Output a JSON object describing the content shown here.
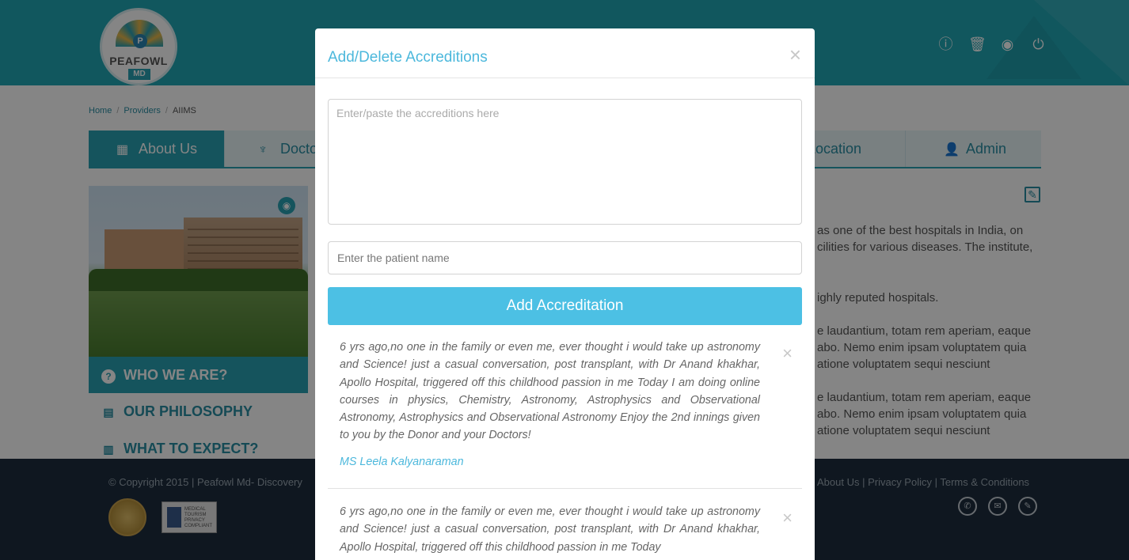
{
  "header": {
    "logo_name": "PEAFOWL",
    "logo_sub": "MD",
    "logo_letter": "P",
    "icons": [
      {
        "name": "info-icon",
        "glyph": "ⓘ"
      },
      {
        "name": "trash-icon",
        "glyph": "🗑"
      },
      {
        "name": "user-circle-icon",
        "glyph": "◉"
      },
      {
        "name": "power-icon",
        "glyph": "⏻"
      }
    ]
  },
  "breadcrumb": {
    "items": [
      "Home",
      "Providers",
      "AIIMS"
    ],
    "sep": "/"
  },
  "tabs": [
    {
      "label": "About Us",
      "icon": "▦"
    },
    {
      "label": "Docto",
      "icon": "♆"
    },
    {
      "label": "Location",
      "icon": ""
    },
    {
      "label": "Admin",
      "icon": "👤"
    }
  ],
  "sidebar": [
    {
      "label": "WHO WE ARE?",
      "icon": "?"
    },
    {
      "label": "OUR PHILOSOPHY",
      "icon": "▤"
    },
    {
      "label": "WHAT TO EXPECT?",
      "icon": "▥"
    }
  ],
  "body_text": [
    "as one of the best hospitals in India, on",
    "cilities for various diseases. The institute,",
    "ighly reputed hospitals.",
    "e laudantium, totam rem aperiam, eaque",
    "abo. Nemo enim ipsam voluptatem quia",
    "ationе voluptatem sequi nesciunt",
    "e laudantium, totam rem aperiam, eaque",
    "abo. Nemo enim ipsam voluptatem quia",
    "ationе voluptatem sequi nesciunt"
  ],
  "footer": {
    "copyright": "© Copyright 2015 | Peafowl Md- Discovery",
    "links": "About Us | Privacy Policy | Terms & Conditions",
    "badge_text": "MEDICAL TOURISM PRIVACY COMPLIANT",
    "social": [
      "✆",
      "✉",
      "✎"
    ]
  },
  "modal": {
    "title": "Add/Delete Accreditions",
    "close_glyph": "×",
    "textarea_placeholder": "Enter/paste the accreditions here",
    "patient_placeholder": "Enter the patient name",
    "add_button": "Add Accreditation",
    "entries": [
      {
        "text": "6 yrs ago,no one in the family or even me, ever thought i would take up astronomy and Science! just a casual conversation, post transplant, with Dr Anand khakhar, Apollo Hospital, triggered off this childhood passion in me Today I am doing online courses in physics, Chemistry, Astronomy, Astrophysics and Observational Astronomy, Astrophysics and Observational Astronomy Enjoy the 2nd innings given to you by the Donor and your Doctors!",
        "author": "MS Leela Kalyanaraman"
      },
      {
        "text": "6 yrs ago,no one in the family or even me, ever thought i would take up astronomy and Science! just a casual conversation, post transplant, with Dr Anand khakhar, Apollo Hospital, triggered off this childhood passion in me Today",
        "author": ""
      }
    ]
  }
}
